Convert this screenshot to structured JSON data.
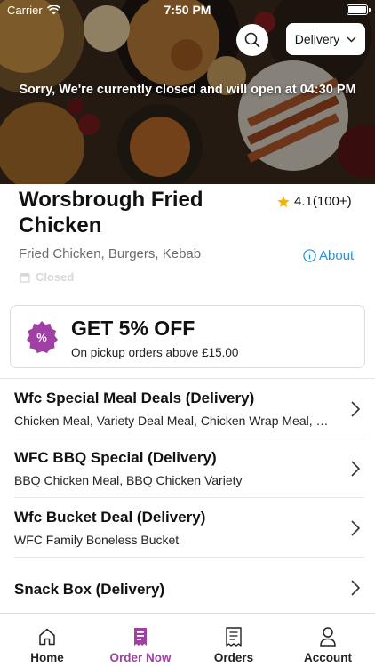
{
  "status_bar": {
    "carrier": "Carrier",
    "time": "7:50 PM"
  },
  "header": {
    "delivery_mode": "Delivery",
    "closed_message": "Sorry, We're currently closed and will open at 04:30 PM"
  },
  "restaurant": {
    "name": "Worsbrough Fried Chicken",
    "rating": "4.1(100+)",
    "cuisine": "Fried Chicken, Burgers, Kebab",
    "about_label": "About",
    "status": "Closed"
  },
  "offer": {
    "title": "GET 5% OFF",
    "subtitle": "On pickup orders above £15.00",
    "badge_symbol": "%"
  },
  "menu": [
    {
      "title": "Wfc Special Meal Deals (Delivery)",
      "description": "Chicken Meal, Variety Deal Meal, Chicken Wrap Meal, Kebab Meal"
    },
    {
      "title": "WFC BBQ Special (Delivery)",
      "description": "BBQ Chicken Meal, BBQ Chicken Variety"
    },
    {
      "title": "Wfc Bucket Deal (Delivery)",
      "description": "WFC Family Boneless Bucket"
    },
    {
      "title": "Snack Box (Delivery)",
      "description": ""
    }
  ],
  "tabs": [
    {
      "label": "Home",
      "icon": "home-icon"
    },
    {
      "label": "Order Now",
      "icon": "order-icon"
    },
    {
      "label": "Orders",
      "icon": "receipt-icon"
    },
    {
      "label": "Account",
      "icon": "person-icon"
    }
  ],
  "colors": {
    "accent": "#a040a5",
    "link": "#2b8fd1",
    "star": "#f5b400"
  }
}
